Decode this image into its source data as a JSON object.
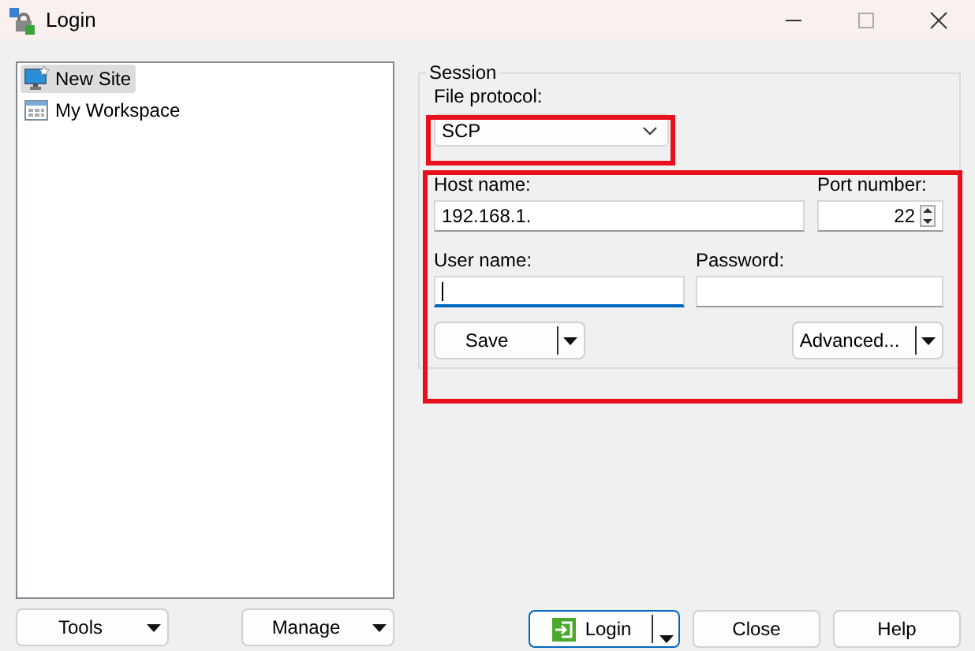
{
  "window": {
    "title": "Login"
  },
  "sites": [
    {
      "kind": "site",
      "label": "New Site",
      "selected": true
    },
    {
      "kind": "workspace",
      "label": "My Workspace",
      "selected": false
    }
  ],
  "session": {
    "title": "Session",
    "protocol": {
      "label": "File protocol:",
      "value": "SCP",
      "highlighted": true
    },
    "connection_highlighted": true,
    "host": {
      "label": "Host name:",
      "value": "192.168.1."
    },
    "port": {
      "label": "Port number:",
      "value": "22"
    },
    "user": {
      "label": "User name:",
      "focused": true
    },
    "password": {
      "label": "Password:"
    },
    "save": "Save",
    "advanced": "Advanced..."
  },
  "left_buttons": [
    "Tools",
    "Manage"
  ],
  "bottom_buttons": [
    {
      "kind": "split",
      "label": "Login",
      "default": true
    },
    {
      "kind": "plain",
      "label": "Close",
      "default": false
    },
    {
      "kind": "plain",
      "label": "Help",
      "default": false
    }
  ]
}
